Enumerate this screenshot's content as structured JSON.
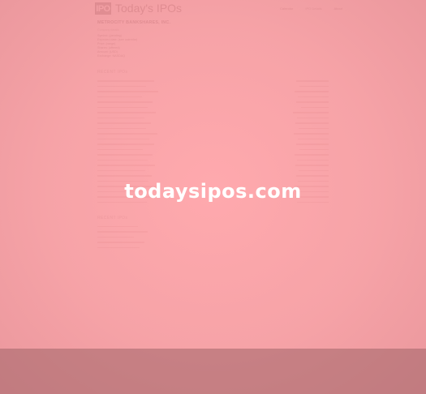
{
  "header": {
    "logo_text": "IPO",
    "site_title": "Today's IPOs",
    "nav": [
      "Calendar",
      "IPO Details",
      "About"
    ]
  },
  "company": {
    "name": "METROCITY BANKSHARES, INC.",
    "subtitle": "Company details",
    "details": [
      "Symbol: (pending)",
      "Expected date: (see calendar)",
      "Price: (range)",
      "Shares: (offered)",
      "Amount: (USD)",
      "Exchange: NASDAQ"
    ],
    "description": ""
  },
  "sections": [
    {
      "heading": "RECENT IPOs",
      "lines": [
        "",
        "",
        "",
        ""
      ]
    },
    {
      "heading": "RECENT IPOs",
      "lines": [
        "",
        "",
        "",
        "",
        ""
      ]
    }
  ],
  "watermark": "todaysipos.com",
  "footer": [
    "",
    "",
    "",
    "",
    "",
    ""
  ],
  "colors": {
    "overlay": "#ff9ea3",
    "footer": "#a0646a",
    "watermark": "#ffffff"
  }
}
